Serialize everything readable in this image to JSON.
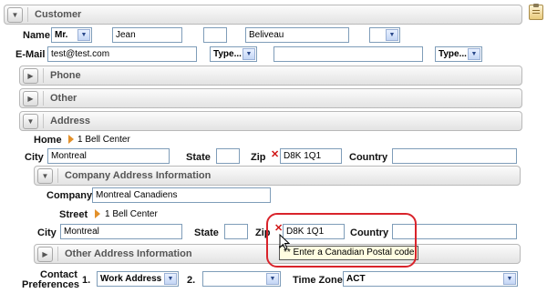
{
  "customer": {
    "section_title": "Customer",
    "name_label": "Name",
    "salutation": "Mr.",
    "first_name": "Jean",
    "middle_name": "",
    "last_name": "Beliveau",
    "suffix": "",
    "email_label": "E-Mail",
    "email_value": "test@test.com",
    "email_type": "Type...",
    "email2_value": "",
    "email2_type": "Type..."
  },
  "sections": {
    "phone": "Phone",
    "other": "Other",
    "address": "Address",
    "company_address": "Company Address Information",
    "other_address": "Other Address Information"
  },
  "home_address": {
    "home_label": "Home",
    "home_link": "1 Bell Center",
    "city_label": "City",
    "city_value": "Montreal",
    "state_label": "State",
    "state_value": "",
    "zip_label": "Zip",
    "zip_value": "D8K 1Q1",
    "country_label": "Country",
    "country_value": ""
  },
  "company_address": {
    "company_label": "Company",
    "company_value": "Montreal Canadiens",
    "street_label": "Street",
    "street_link": "1 Bell Center",
    "city_label": "City",
    "city_value": "Montreal",
    "state_label": "State",
    "state_value": "",
    "zip_label": "Zip",
    "zip_value": "D8K 1Q1",
    "country_label": "Country",
    "country_value": "",
    "tooltip": "** Enter a Canadian Postal code"
  },
  "contact": {
    "label_line1": "Contact",
    "label_line2": "Preferences",
    "pref1_num": "1.",
    "pref1_value": "Work Address",
    "pref2_num": "2.",
    "pref2_value": "",
    "timezone_label": "Time Zone",
    "timezone_value": "ACT"
  },
  "colors": {
    "highlight_ring": "#d9232b",
    "field_border": "#7f9db9",
    "error_x": "#d01616",
    "link_arrow": "#e2902a"
  }
}
